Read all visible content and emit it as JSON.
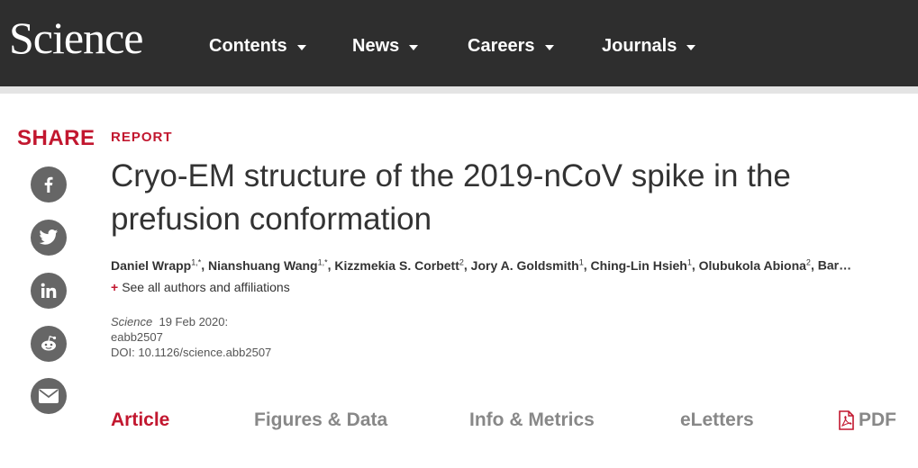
{
  "header": {
    "logo": "Science",
    "nav": [
      {
        "label": "Contents"
      },
      {
        "label": "News"
      },
      {
        "label": "Careers"
      },
      {
        "label": "Journals"
      }
    ]
  },
  "share": {
    "title": "SHARE",
    "buttons": [
      "facebook-icon",
      "twitter-icon",
      "linkedin-icon",
      "reddit-icon",
      "email-icon"
    ]
  },
  "article": {
    "kicker": "REPORT",
    "title": "Cryo-EM structure of the 2019-nCoV spike in the prefusion conformation",
    "authors": [
      {
        "name": "Daniel Wrapp",
        "sup": "1,*"
      },
      {
        "name": "Nianshuang Wang",
        "sup": "1,*"
      },
      {
        "name": "Kizzmekia S. Corbett",
        "sup": "2"
      },
      {
        "name": "Jory A. Goldsmith",
        "sup": "1"
      },
      {
        "name": "Ching-Lin Hsieh",
        "sup": "1"
      },
      {
        "name": "Olubukola Abiona",
        "sup": "2"
      },
      {
        "name": "Bar…",
        "sup": ""
      }
    ],
    "see_all": "See all authors and affiliations",
    "citation": {
      "journal": "Science",
      "date": "19 Feb 2020:",
      "id": "eabb2507",
      "doi": "DOI: 10.1126/science.abb2507"
    }
  },
  "tabs": {
    "article": "Article",
    "figures": "Figures & Data",
    "info": "Info & Metrics",
    "eletters": "eLetters",
    "pdf": "PDF"
  },
  "colors": {
    "accent": "#c2172f",
    "header_bg": "#2e2e2e",
    "share_icon_bg": "#666666"
  }
}
